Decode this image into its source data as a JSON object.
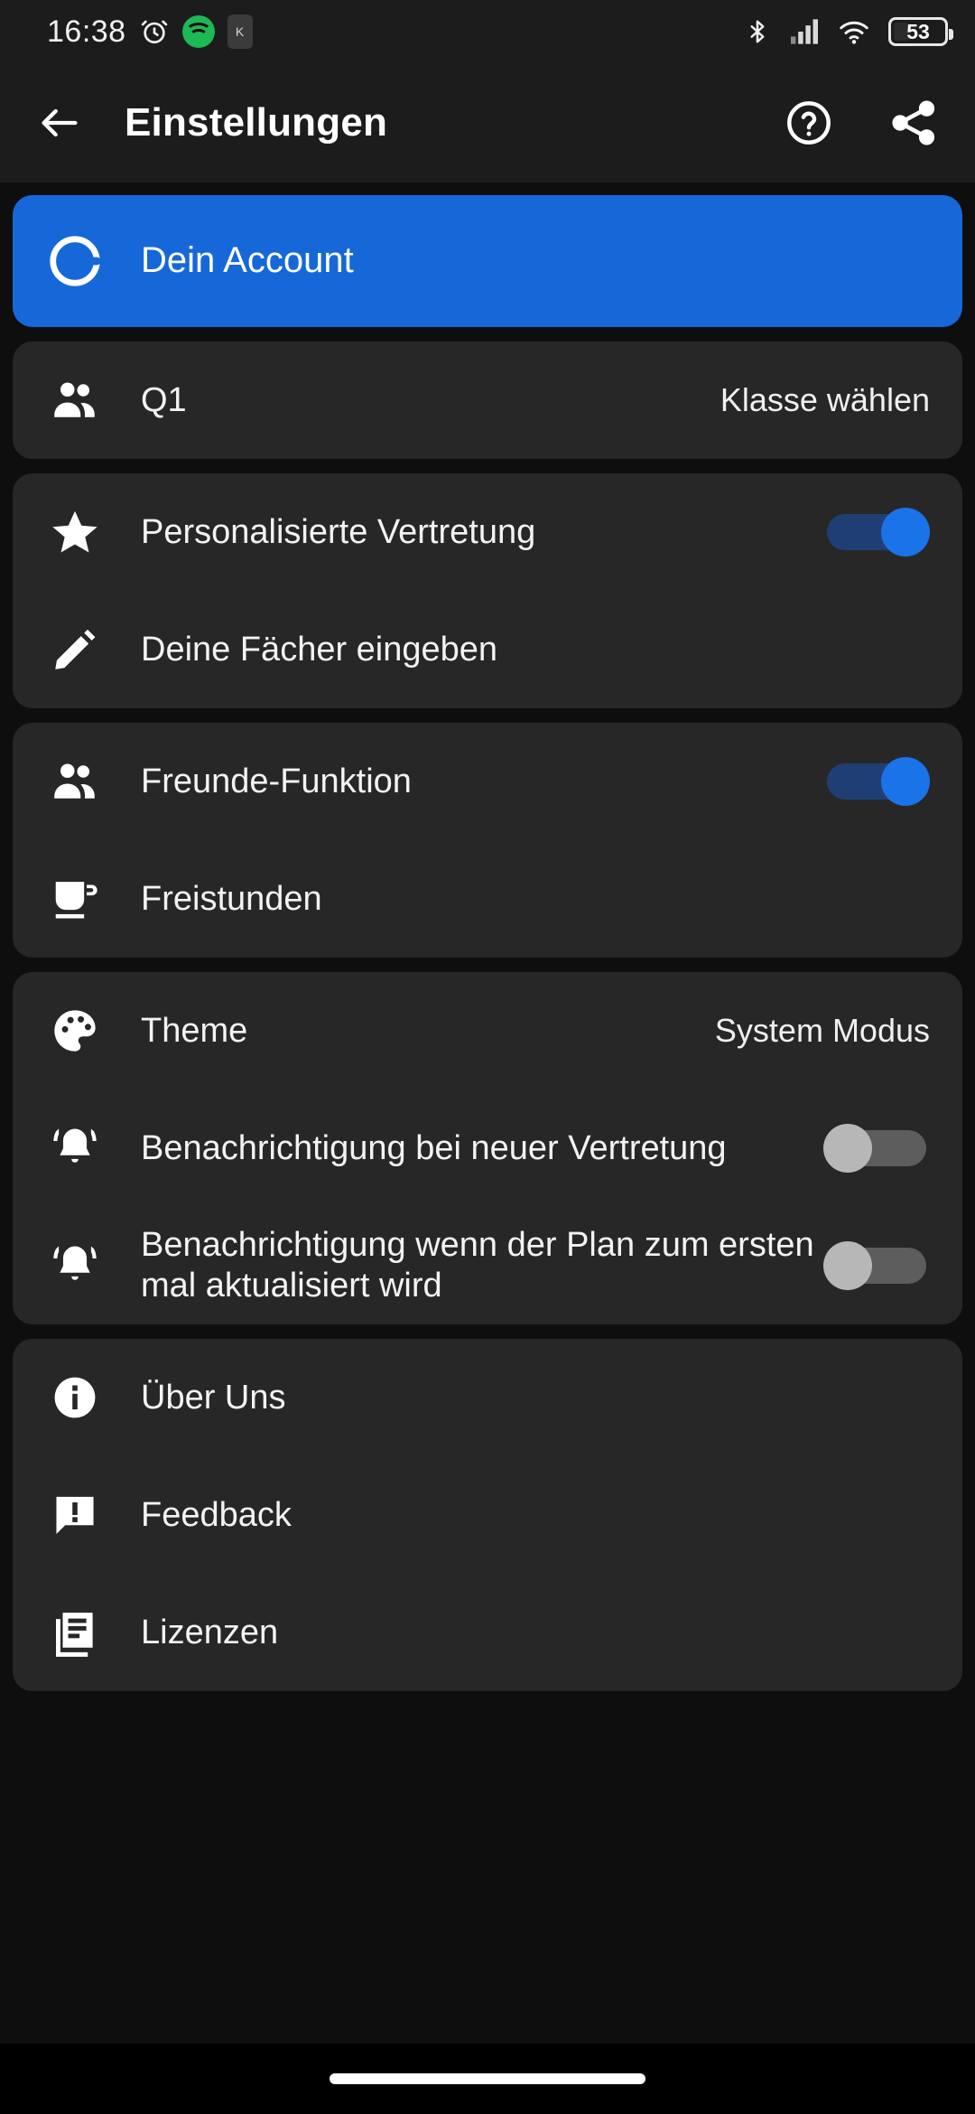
{
  "statusbar": {
    "time": "16:38",
    "icons": [
      "alarm-icon",
      "spotify-icon",
      "app-notification-icon"
    ],
    "app_badge": "K",
    "right_icons": [
      "bluetooth-icon",
      "cellular-signal-icon",
      "wifi-icon"
    ],
    "battery_percent": "53"
  },
  "appbar": {
    "back_label": "back-arrow",
    "title": "Einstellungen",
    "help_label": "help",
    "share_label": "share"
  },
  "colors": {
    "accent_blue": "#1668d8",
    "toggle_on_thumb": "#1a73e8",
    "toggle_on_track": "#1f3f74",
    "toggle_off_thumb": "#b7b7b7",
    "toggle_off_track": "#5d5d5d",
    "card_background": "#272727",
    "page_background": "#0e0e0e"
  },
  "cards": [
    {
      "style": "blue",
      "rows": [
        {
          "icon": "account-circle-icon",
          "label": "Dein Account",
          "type": "link"
        }
      ]
    },
    {
      "style": "default",
      "rows": [
        {
          "icon": "people-icon",
          "label": "Q1",
          "value": "Klasse wählen",
          "type": "value"
        }
      ]
    },
    {
      "style": "default",
      "rows": [
        {
          "icon": "star-icon",
          "label": "Personalisierte Vertretung",
          "type": "toggle",
          "toggle": "on"
        },
        {
          "icon": "pencil-icon",
          "label": "Deine Fächer eingeben",
          "type": "link"
        }
      ]
    },
    {
      "style": "default",
      "rows": [
        {
          "icon": "people-icon",
          "label": "Freunde-Funktion",
          "type": "toggle",
          "toggle": "on"
        },
        {
          "icon": "coffee-cup-icon",
          "label": "Freistunden",
          "type": "link"
        }
      ]
    },
    {
      "style": "default",
      "rows": [
        {
          "icon": "palette-icon",
          "label": "Theme",
          "value": "System Modus",
          "type": "value"
        },
        {
          "icon": "bell-ring-icon",
          "label": "Benachrichtigung bei neuer Vertretung",
          "type": "toggle",
          "toggle": "off"
        },
        {
          "icon": "bell-ring-icon",
          "label": "Benachrichtigung wenn der Plan zum ersten mal aktualisiert wird",
          "type": "toggle",
          "toggle": "off"
        }
      ]
    },
    {
      "style": "default",
      "rows": [
        {
          "icon": "info-icon",
          "label": "Über Uns",
          "type": "link"
        },
        {
          "icon": "feedback-icon",
          "label": "Feedback",
          "type": "link"
        },
        {
          "icon": "license-document-icon",
          "label": "Lizenzen",
          "type": "link"
        }
      ]
    }
  ]
}
